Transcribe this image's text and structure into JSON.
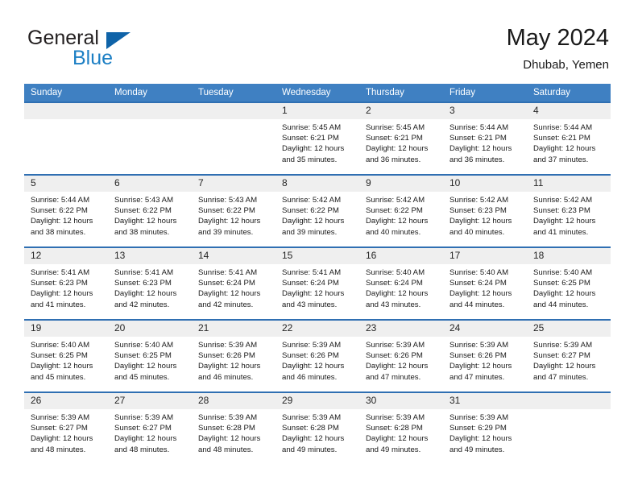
{
  "brand": {
    "name_part1": "General",
    "name_part2": "Blue",
    "flag_icon": "triangle-flag-icon"
  },
  "header": {
    "title": "May 2024",
    "subtitle": "Dhubab, Yemen"
  },
  "colors": {
    "header_blue": "#3f80c2",
    "row_border_blue": "#2f6fb2",
    "daynum_bg": "#efefef",
    "brand_blue": "#1c7fc4",
    "brand_flag": "#0f63a8",
    "text": "#1a1a1a"
  },
  "weekday_headers": [
    "Sunday",
    "Monday",
    "Tuesday",
    "Wednesday",
    "Thursday",
    "Friday",
    "Saturday"
  ],
  "weeks": [
    [
      {
        "day": "",
        "lines": []
      },
      {
        "day": "",
        "lines": []
      },
      {
        "day": "",
        "lines": []
      },
      {
        "day": "1",
        "lines": [
          "Sunrise: 5:45 AM",
          "Sunset: 6:21 PM",
          "Daylight: 12 hours",
          "and 35 minutes."
        ]
      },
      {
        "day": "2",
        "lines": [
          "Sunrise: 5:45 AM",
          "Sunset: 6:21 PM",
          "Daylight: 12 hours",
          "and 36 minutes."
        ]
      },
      {
        "day": "3",
        "lines": [
          "Sunrise: 5:44 AM",
          "Sunset: 6:21 PM",
          "Daylight: 12 hours",
          "and 36 minutes."
        ]
      },
      {
        "day": "4",
        "lines": [
          "Sunrise: 5:44 AM",
          "Sunset: 6:21 PM",
          "Daylight: 12 hours",
          "and 37 minutes."
        ]
      }
    ],
    [
      {
        "day": "5",
        "lines": [
          "Sunrise: 5:44 AM",
          "Sunset: 6:22 PM",
          "Daylight: 12 hours",
          "and 38 minutes."
        ]
      },
      {
        "day": "6",
        "lines": [
          "Sunrise: 5:43 AM",
          "Sunset: 6:22 PM",
          "Daylight: 12 hours",
          "and 38 minutes."
        ]
      },
      {
        "day": "7",
        "lines": [
          "Sunrise: 5:43 AM",
          "Sunset: 6:22 PM",
          "Daylight: 12 hours",
          "and 39 minutes."
        ]
      },
      {
        "day": "8",
        "lines": [
          "Sunrise: 5:42 AM",
          "Sunset: 6:22 PM",
          "Daylight: 12 hours",
          "and 39 minutes."
        ]
      },
      {
        "day": "9",
        "lines": [
          "Sunrise: 5:42 AM",
          "Sunset: 6:22 PM",
          "Daylight: 12 hours",
          "and 40 minutes."
        ]
      },
      {
        "day": "10",
        "lines": [
          "Sunrise: 5:42 AM",
          "Sunset: 6:23 PM",
          "Daylight: 12 hours",
          "and 40 minutes."
        ]
      },
      {
        "day": "11",
        "lines": [
          "Sunrise: 5:42 AM",
          "Sunset: 6:23 PM",
          "Daylight: 12 hours",
          "and 41 minutes."
        ]
      }
    ],
    [
      {
        "day": "12",
        "lines": [
          "Sunrise: 5:41 AM",
          "Sunset: 6:23 PM",
          "Daylight: 12 hours",
          "and 41 minutes."
        ]
      },
      {
        "day": "13",
        "lines": [
          "Sunrise: 5:41 AM",
          "Sunset: 6:23 PM",
          "Daylight: 12 hours",
          "and 42 minutes."
        ]
      },
      {
        "day": "14",
        "lines": [
          "Sunrise: 5:41 AM",
          "Sunset: 6:24 PM",
          "Daylight: 12 hours",
          "and 42 minutes."
        ]
      },
      {
        "day": "15",
        "lines": [
          "Sunrise: 5:41 AM",
          "Sunset: 6:24 PM",
          "Daylight: 12 hours",
          "and 43 minutes."
        ]
      },
      {
        "day": "16",
        "lines": [
          "Sunrise: 5:40 AM",
          "Sunset: 6:24 PM",
          "Daylight: 12 hours",
          "and 43 minutes."
        ]
      },
      {
        "day": "17",
        "lines": [
          "Sunrise: 5:40 AM",
          "Sunset: 6:24 PM",
          "Daylight: 12 hours",
          "and 44 minutes."
        ]
      },
      {
        "day": "18",
        "lines": [
          "Sunrise: 5:40 AM",
          "Sunset: 6:25 PM",
          "Daylight: 12 hours",
          "and 44 minutes."
        ]
      }
    ],
    [
      {
        "day": "19",
        "lines": [
          "Sunrise: 5:40 AM",
          "Sunset: 6:25 PM",
          "Daylight: 12 hours",
          "and 45 minutes."
        ]
      },
      {
        "day": "20",
        "lines": [
          "Sunrise: 5:40 AM",
          "Sunset: 6:25 PM",
          "Daylight: 12 hours",
          "and 45 minutes."
        ]
      },
      {
        "day": "21",
        "lines": [
          "Sunrise: 5:39 AM",
          "Sunset: 6:26 PM",
          "Daylight: 12 hours",
          "and 46 minutes."
        ]
      },
      {
        "day": "22",
        "lines": [
          "Sunrise: 5:39 AM",
          "Sunset: 6:26 PM",
          "Daylight: 12 hours",
          "and 46 minutes."
        ]
      },
      {
        "day": "23",
        "lines": [
          "Sunrise: 5:39 AM",
          "Sunset: 6:26 PM",
          "Daylight: 12 hours",
          "and 47 minutes."
        ]
      },
      {
        "day": "24",
        "lines": [
          "Sunrise: 5:39 AM",
          "Sunset: 6:26 PM",
          "Daylight: 12 hours",
          "and 47 minutes."
        ]
      },
      {
        "day": "25",
        "lines": [
          "Sunrise: 5:39 AM",
          "Sunset: 6:27 PM",
          "Daylight: 12 hours",
          "and 47 minutes."
        ]
      }
    ],
    [
      {
        "day": "26",
        "lines": [
          "Sunrise: 5:39 AM",
          "Sunset: 6:27 PM",
          "Daylight: 12 hours",
          "and 48 minutes."
        ]
      },
      {
        "day": "27",
        "lines": [
          "Sunrise: 5:39 AM",
          "Sunset: 6:27 PM",
          "Daylight: 12 hours",
          "and 48 minutes."
        ]
      },
      {
        "day": "28",
        "lines": [
          "Sunrise: 5:39 AM",
          "Sunset: 6:28 PM",
          "Daylight: 12 hours",
          "and 48 minutes."
        ]
      },
      {
        "day": "29",
        "lines": [
          "Sunrise: 5:39 AM",
          "Sunset: 6:28 PM",
          "Daylight: 12 hours",
          "and 49 minutes."
        ]
      },
      {
        "day": "30",
        "lines": [
          "Sunrise: 5:39 AM",
          "Sunset: 6:28 PM",
          "Daylight: 12 hours",
          "and 49 minutes."
        ]
      },
      {
        "day": "31",
        "lines": [
          "Sunrise: 5:39 AM",
          "Sunset: 6:29 PM",
          "Daylight: 12 hours",
          "and 49 minutes."
        ]
      },
      {
        "day": "",
        "lines": []
      }
    ]
  ]
}
